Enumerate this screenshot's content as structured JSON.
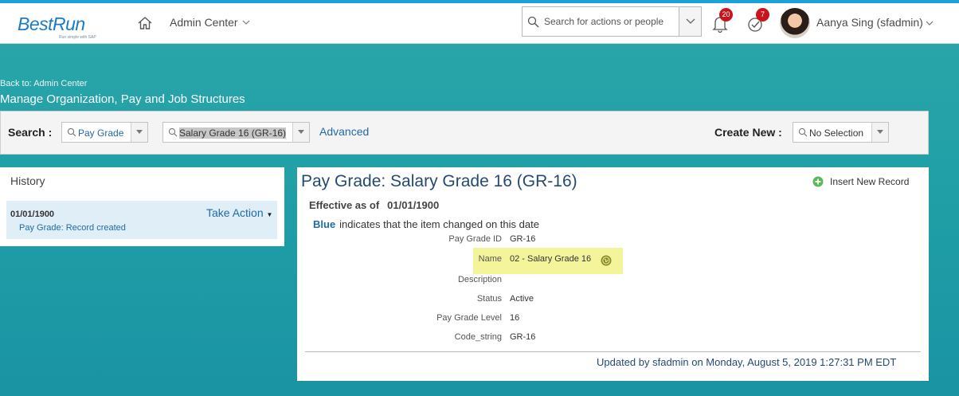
{
  "shell": {
    "logo_text": "BestRun",
    "logo_tagline": "Run simple with SAP",
    "nav_label": "Admin Center",
    "search_placeholder": "Search for actions or people",
    "notifications_count": "20",
    "tasks_count": "7",
    "user_name": "Aanya Sing (sfadmin)"
  },
  "page": {
    "back_link": "Back to: Admin Center",
    "title": "Manage Organization, Pay and Job Structures"
  },
  "searchbar": {
    "search_label": "Search :",
    "type_value": "Pay Grade",
    "record_value": "Salary Grade 16 (GR-16)",
    "advanced_label": "Advanced",
    "create_label": "Create New :",
    "create_value": "No Selection"
  },
  "history": {
    "heading": "History",
    "entry_date": "01/01/1900",
    "action_label": "Take Action",
    "entry_text": "Pay Grade: Record created"
  },
  "record": {
    "title": "Pay Grade: Salary Grade 16 (GR-16)",
    "insert_label": "Insert New Record",
    "effective_label": "Effective as of",
    "effective_date": "01/01/1900",
    "note_keyword": "Blue",
    "note_text": "indicates that the item changed on this date",
    "fields": [
      {
        "label": "Pay Grade ID",
        "value": "GR-16"
      },
      {
        "label": "Name",
        "value": "02 - Salary Grade 16"
      },
      {
        "label": "Description",
        "value": ""
      },
      {
        "label": "Status",
        "value": "Active"
      },
      {
        "label": "Pay Grade Level",
        "value": "16"
      },
      {
        "label": "Code_string",
        "value": "GR-16"
      }
    ],
    "updated_text": "Updated by sfadmin on Monday, August 5, 2019 1:27:31 PM EDT"
  },
  "colors": {
    "brand_blue": "#1d7bc4",
    "link_blue": "#1f6aa8",
    "header_teal": "#2aa7a9",
    "highlight_yellow": "#f4f59a",
    "badge_red": "#c8151d"
  }
}
